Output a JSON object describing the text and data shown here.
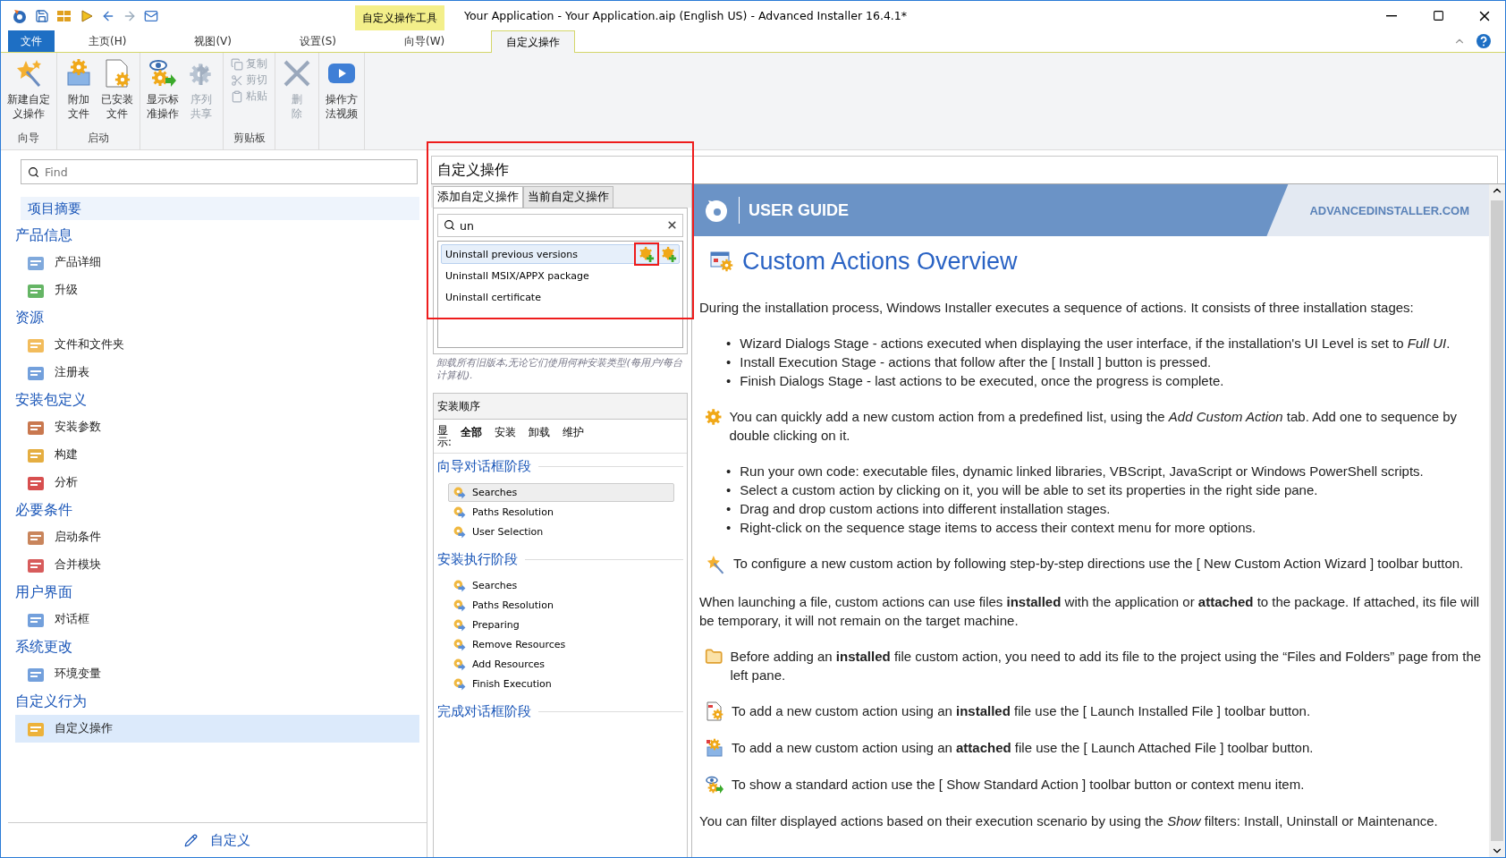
{
  "window": {
    "title": "Your Application - Your Application.aip (English US) - Advanced Installer 16.4.1*",
    "context_tab_group": "自定义操作工具"
  },
  "menu_tabs": [
    {
      "label": "文件",
      "kind": "file",
      "selected": false
    },
    {
      "label": "主页(H)",
      "kind": "tab",
      "selected": false
    },
    {
      "label": "视图(V)",
      "kind": "tab",
      "selected": false
    },
    {
      "label": "设置(S)",
      "kind": "tab",
      "selected": false
    },
    {
      "label": "向导(W)",
      "kind": "tab",
      "selected": false
    },
    {
      "label": "自定义操作",
      "kind": "context",
      "selected": true
    }
  ],
  "ribbon": {
    "groups": [
      {
        "label": "向导",
        "buttons": [
          {
            "lines": [
              "新建自定",
              "义操作"
            ],
            "kind": "large",
            "disabled": false
          }
        ]
      },
      {
        "label": "启动",
        "buttons": [
          {
            "lines": [
              "附加",
              "文件"
            ],
            "kind": "large",
            "disabled": false
          },
          {
            "lines": [
              "已安装",
              "文件"
            ],
            "kind": "large",
            "disabled": false
          }
        ]
      },
      {
        "buttons": [
          {
            "lines": [
              "显示标",
              "准操作"
            ],
            "kind": "large",
            "disabled": false
          },
          {
            "lines": [
              "序列",
              "共享"
            ],
            "kind": "large",
            "disabled": true
          }
        ]
      },
      {
        "label": "剪贴板",
        "buttons": [
          {
            "lines": [
              "复制"
            ],
            "kind": "small",
            "disabled": true
          },
          {
            "lines": [
              "剪切"
            ],
            "kind": "small",
            "disabled": true
          },
          {
            "lines": [
              "粘贴"
            ],
            "kind": "small",
            "disabled": true
          }
        ]
      },
      {
        "buttons": [
          {
            "lines": [
              "删",
              "除"
            ],
            "kind": "large",
            "disabled": true
          }
        ]
      },
      {
        "buttons": [
          {
            "lines": [
              "操作方",
              "法视频"
            ],
            "kind": "large",
            "disabled": false
          }
        ]
      }
    ]
  },
  "left_pane": {
    "search": {
      "placeholder": "Find"
    },
    "summary": {
      "label": "项目摘要",
      "selected": false
    },
    "groups": [
      {
        "title": "产品信息",
        "items": [
          {
            "label": "产品详细",
            "selected": false
          },
          {
            "label": "升级",
            "selected": false
          }
        ]
      },
      {
        "title": "资源",
        "items": [
          {
            "label": "文件和文件夹",
            "selected": false
          },
          {
            "label": "注册表",
            "selected": false
          }
        ]
      },
      {
        "title": "安装包定义",
        "items": [
          {
            "label": "安装参数",
            "selected": false
          },
          {
            "label": "构建",
            "selected": false
          },
          {
            "label": "分析",
            "selected": false
          }
        ]
      },
      {
        "title": "必要条件",
        "items": [
          {
            "label": "启动条件",
            "selected": false
          },
          {
            "label": "合并模块",
            "selected": false
          }
        ]
      },
      {
        "title": "用户界面",
        "items": [
          {
            "label": "对话框",
            "selected": false
          }
        ]
      },
      {
        "title": "系统更改",
        "items": [
          {
            "label": "环境变量",
            "selected": false
          }
        ]
      },
      {
        "title": "自定义行为",
        "items": [
          {
            "label": "自定义操作",
            "selected": true
          }
        ]
      }
    ],
    "footer": "自定义"
  },
  "page_header": "自定义操作",
  "actions_panel": {
    "tabs": [
      {
        "label": "添加自定义操作",
        "selected": true
      },
      {
        "label": "当前自定义操作",
        "selected": false
      }
    ],
    "search": {
      "value": "un"
    },
    "results": [
      {
        "label": "Uninstall previous versions",
        "selected": true
      },
      {
        "label": "Uninstall MSIX/APPX package",
        "selected": false
      },
      {
        "label": "Uninstall certificate",
        "selected": false
      }
    ],
    "description": "卸载所有旧版本,无论它们使用何种安装类型(每用户/每台计算机)."
  },
  "sequence_panel": {
    "title": "安装顺序",
    "show_label": "显示:",
    "filters": [
      {
        "label": "全部",
        "selected": true
      },
      {
        "label": "安装",
        "selected": false
      },
      {
        "label": "卸载",
        "selected": false
      },
      {
        "label": "维护",
        "selected": false
      }
    ],
    "stages": [
      {
        "title": "向导对话框阶段",
        "items": [
          {
            "label": "Searches",
            "selected": true
          },
          {
            "label": "Paths Resolution",
            "selected": false
          },
          {
            "label": "User Selection",
            "selected": false
          }
        ]
      },
      {
        "title": "安装执行阶段",
        "items": [
          {
            "label": "Searches",
            "selected": false
          },
          {
            "label": "Paths Resolution",
            "selected": false
          },
          {
            "label": "Preparing",
            "selected": false
          },
          {
            "label": "Remove Resources",
            "selected": false
          },
          {
            "label": "Add Resources",
            "selected": false
          },
          {
            "label": "Finish Execution",
            "selected": false
          }
        ]
      },
      {
        "title": "完成对话框阶段"
      }
    ]
  },
  "guide": {
    "banner": "USER GUIDE",
    "site": "ADVANCEDINSTALLER.COM",
    "title": "Custom Actions Overview",
    "blocks": [
      {
        "kind": "para",
        "text": "During the installation process, Windows Installer executes a sequence of actions. It consists of three installation stages:"
      },
      {
        "kind": "bullets",
        "marker": "•",
        "items": [
          "Wizard Dialogs Stage - actions executed when displaying the user interface, if the installation's UI Level is set to *Full UI*.",
          "Install Execution Stage - actions that follow after the [ Install ] button is pressed.",
          "Finish Dialogs Stage - last actions to be executed, once the progress is complete."
        ]
      },
      {
        "kind": "note",
        "text": "You can quickly add a new custom action from a predefined list, using the *Add Custom Action* tab. Add one to sequence by double clicking on it."
      },
      {
        "kind": "bullets",
        "marker": "•",
        "items": [
          "Run your own code: executable files, dynamic linked libraries, VBScript, JavaScript or Windows PowerShell scripts.",
          "Select a custom action by clicking on it, you will be able to set its properties in the right side pane.",
          "Drag and drop custom actions into different installation stages.",
          "Right-click on the sequence stage items to access their context menu for more options."
        ]
      },
      {
        "kind": "note",
        "text": "To configure a new custom action by following step-by-step directions use the [ New Custom Action Wizard ] toolbar button."
      },
      {
        "kind": "para",
        "text": "When launching a file, custom actions can use files **installed** with the application or **attached** to the package. If attached, its file will be temporary, it will not remain on the target machine."
      },
      {
        "kind": "note",
        "text": "Before adding an **installed** file custom action, you need to add its file to the project using the “Files and Folders” page from the left pane."
      },
      {
        "kind": "note",
        "text": "To add a new custom action using an **installed** file use the [ Launch Installed File ] toolbar button."
      },
      {
        "kind": "note",
        "text": "To add a new custom action using an **attached** file use the [ Launch Attached File ] toolbar button."
      },
      {
        "kind": "note",
        "text": "To show a standard action use the [ Show Standard Action ] toolbar button or context menu item."
      },
      {
        "kind": "para",
        "text": "You can filter displayed actions based on their execution scenario by using the *Show* filters: Install, Uninstall or Maintenance."
      }
    ]
  }
}
